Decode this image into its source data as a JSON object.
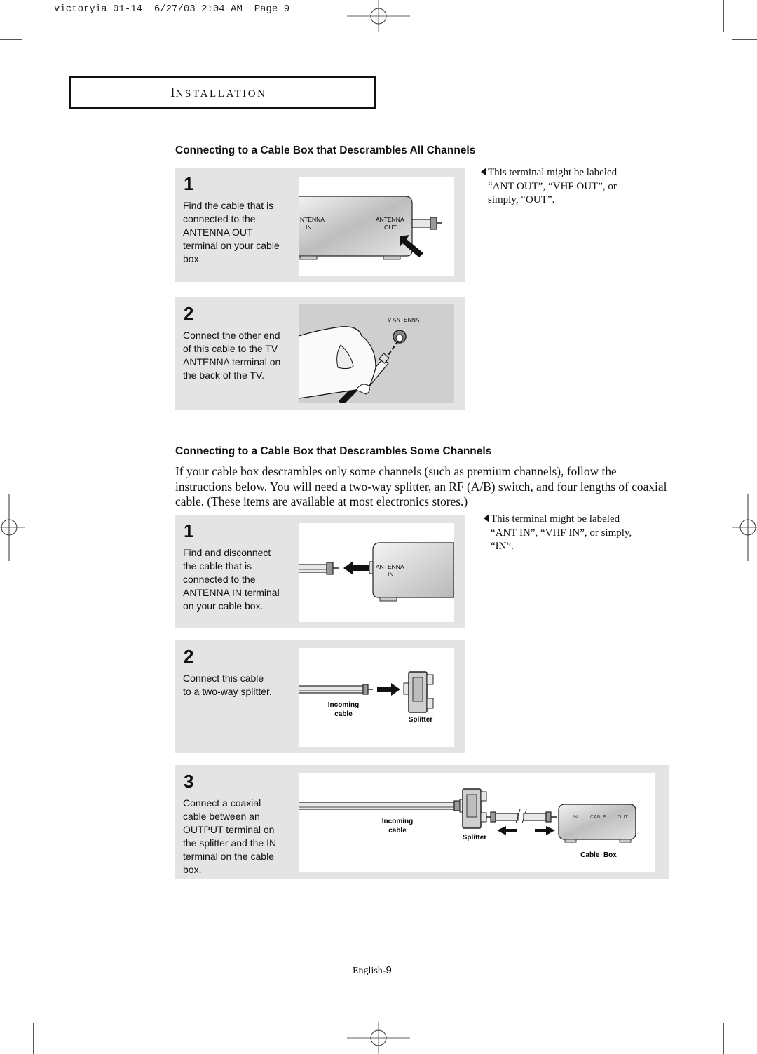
{
  "print_header": {
    "slug": "victoryia 01-14",
    "date": "6/27/03",
    "time": "2:04 AM",
    "page_label": "Page 9"
  },
  "section": {
    "title_initial": "I",
    "title_rest": "NSTALLATION"
  },
  "all_channels": {
    "heading": "Connecting to a Cable Box that Descrambles All Channels",
    "steps": [
      {
        "number": "1",
        "lines": [
          "Find the cable that is",
          "connected to the",
          "ANTENNA OUT",
          "terminal on your cable",
          "box."
        ],
        "illustration": {
          "labels": [
            "NTENNA",
            "IN",
            "ANTENNA",
            "OUT"
          ]
        }
      },
      {
        "number": "2",
        "lines": [
          "Connect the other end",
          "of this cable to the TV",
          "ANTENNA terminal on",
          "the back of the TV."
        ],
        "illustration": {
          "labels": [
            "TV ANTENNA"
          ]
        }
      }
    ],
    "note": {
      "lines": [
        "This terminal might be labeled",
        "“ANT OUT”, “VHF OUT”, or",
        "simply, “OUT”."
      ]
    }
  },
  "some_channels": {
    "heading": "Connecting to a Cable Box that Descrambles Some Channels",
    "intro": "If your cable box descrambles only some channels (such as premium channels), follow the instructions below. You will need a two-way splitter, an RF (A/B) switch, and four lengths of coaxial cable. (These items are available at most electronics stores.)",
    "steps": [
      {
        "number": "1",
        "lines": [
          "Find and disconnect",
          "the cable that is",
          "connected to the",
          "ANTENNA IN terminal",
          "on your cable box."
        ],
        "illustration": {
          "labels": [
            "ANTENNA",
            "IN"
          ]
        }
      },
      {
        "number": "2",
        "lines": [
          "Connect this cable",
          "to a two-way splitter."
        ],
        "illustration": {
          "labels": [
            "Incoming",
            "cable",
            "Splitter"
          ]
        }
      },
      {
        "number": "3",
        "lines": [
          "Connect a coaxial",
          "cable between an",
          "OUTPUT terminal on",
          "the splitter and the IN",
          "terminal on the cable",
          "box."
        ],
        "illustration": {
          "labels": [
            "Incoming",
            "cable",
            "Splitter",
            "IN",
            "CABLE",
            "OUT",
            "Cable  Box"
          ]
        }
      }
    ],
    "note": {
      "lines": [
        "This terminal might be labeled",
        "“ANT IN”, “VHF IN”, or simply,",
        "“IN”."
      ]
    }
  },
  "footer": {
    "language": "English-",
    "page_number": "9"
  }
}
